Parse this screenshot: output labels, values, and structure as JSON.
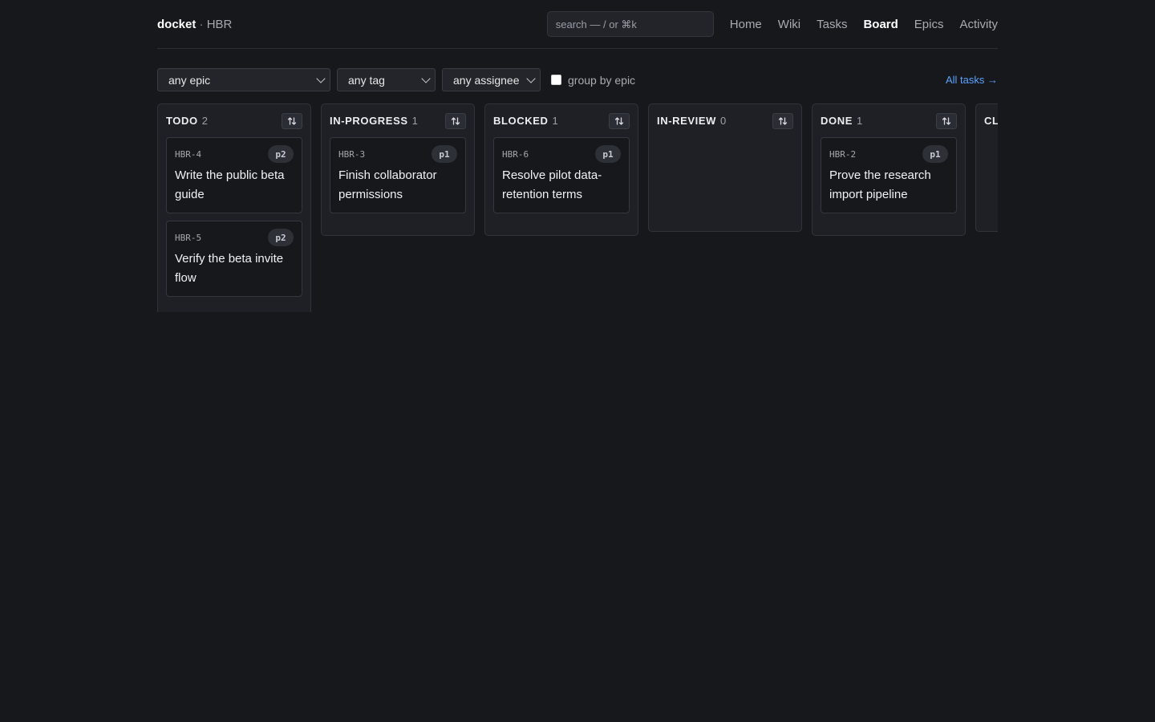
{
  "header": {
    "brand": "docket",
    "separator": "·",
    "project": "HBR",
    "search_placeholder": "search — / or ⌘k",
    "nav": [
      {
        "label": "Home",
        "active": false
      },
      {
        "label": "Wiki",
        "active": false
      },
      {
        "label": "Tasks",
        "active": false
      },
      {
        "label": "Board",
        "active": true
      },
      {
        "label": "Epics",
        "active": false
      },
      {
        "label": "Activity",
        "active": false
      }
    ]
  },
  "filters": {
    "epic": "any epic",
    "tag": "any tag",
    "assignee": "any assignee",
    "group_by_epic_label": "group by epic",
    "group_by_epic_checked": false,
    "all_tasks_link": "All tasks →"
  },
  "columns": [
    {
      "title": "TODO",
      "count": "2",
      "cards": [
        {
          "key": "HBR-4",
          "priority": "p2",
          "title": "Write the public beta guide"
        },
        {
          "key": "HBR-5",
          "priority": "p2",
          "title": "Verify the beta invite flow"
        }
      ]
    },
    {
      "title": "IN-PROGRESS",
      "count": "1",
      "cards": [
        {
          "key": "HBR-3",
          "priority": "p1",
          "title": "Finish collaborator permissions"
        }
      ]
    },
    {
      "title": "BLOCKED",
      "count": "1",
      "cards": [
        {
          "key": "HBR-6",
          "priority": "p1",
          "title": "Resolve pilot data-retention terms"
        }
      ]
    },
    {
      "title": "IN-REVIEW",
      "count": "0",
      "cards": []
    },
    {
      "title": "DONE",
      "count": "1",
      "cards": [
        {
          "key": "HBR-2",
          "priority": "p1",
          "title": "Prove the research import pipeline"
        }
      ]
    },
    {
      "title": "CL",
      "count": "",
      "cards": []
    }
  ],
  "icons": {
    "sort": "sort-arrows-icon",
    "dropdown": "chevron-down-icon",
    "arrow": "arrow-right-icon"
  },
  "colors": {
    "background": "#17181b",
    "column_bg": "#1e2025",
    "link": "#5aa2ff"
  }
}
